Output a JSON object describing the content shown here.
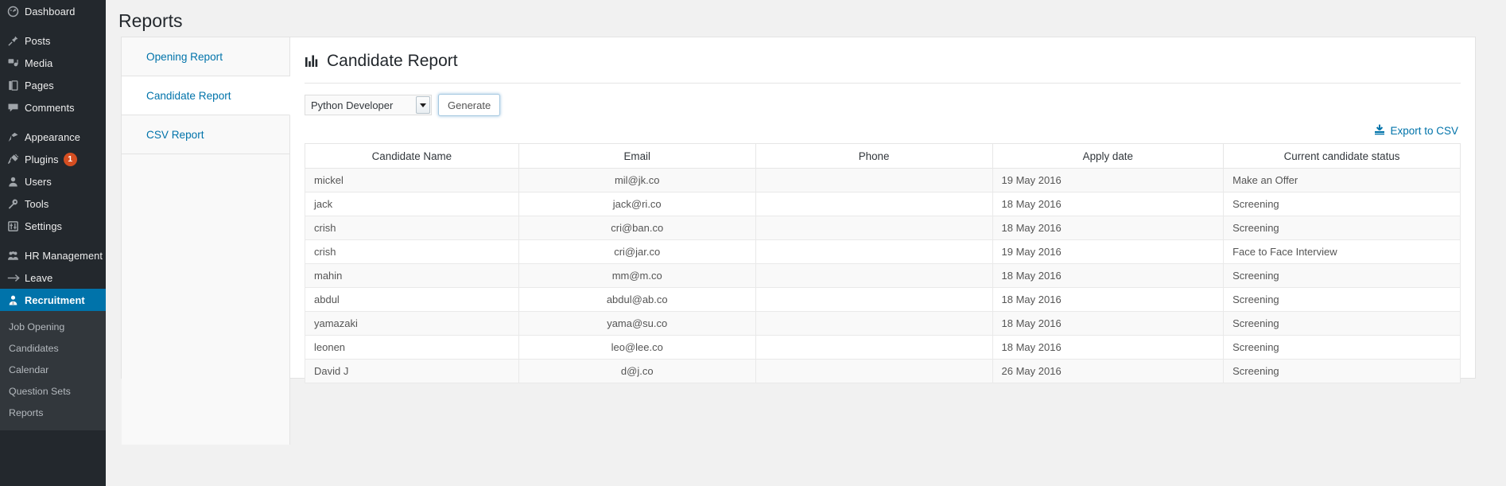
{
  "sidebar": {
    "groups": [
      {
        "items": [
          {
            "label": "Dashboard",
            "icon": "dashboard-gauge-icon",
            "name": "dashboard"
          }
        ]
      },
      {
        "items": [
          {
            "label": "Posts",
            "icon": "pin-icon",
            "name": "posts"
          },
          {
            "label": "Media",
            "icon": "media-icon",
            "name": "media"
          },
          {
            "label": "Pages",
            "icon": "pages-icon",
            "name": "pages"
          },
          {
            "label": "Comments",
            "icon": "comment-bubble-icon",
            "name": "comments"
          }
        ]
      },
      {
        "items": [
          {
            "label": "Appearance",
            "icon": "paintbrush-icon",
            "name": "appearance"
          },
          {
            "label": "Plugins",
            "icon": "plug-icon",
            "name": "plugins",
            "badge": "1"
          },
          {
            "label": "Users",
            "icon": "user-icon",
            "name": "users"
          },
          {
            "label": "Tools",
            "icon": "wrench-icon",
            "name": "tools"
          },
          {
            "label": "Settings",
            "icon": "sliders-icon",
            "name": "settings"
          }
        ]
      },
      {
        "items": [
          {
            "label": "HR Management",
            "icon": "group-people-icon",
            "name": "hr-management"
          },
          {
            "label": "Leave",
            "icon": "arrow-right-icon",
            "name": "leave"
          },
          {
            "label": "Recruitment",
            "icon": "user-badge-icon",
            "name": "recruitment",
            "current": true
          }
        ]
      }
    ],
    "submenu": {
      "items": [
        {
          "label": "Job Opening",
          "name": "job-opening"
        },
        {
          "label": "Candidates",
          "name": "candidates"
        },
        {
          "label": "Calendar",
          "name": "calendar"
        },
        {
          "label": "Question Sets",
          "name": "question-sets"
        },
        {
          "label": "Reports",
          "name": "reports"
        }
      ]
    },
    "colors": {
      "background": "#23282d",
      "submenu_background": "#32373c",
      "current": "#0073aa",
      "badge": "#d54e21"
    }
  },
  "page": {
    "title": "Reports"
  },
  "tabs": [
    {
      "label": "Opening Report",
      "name": "tab-opening-report",
      "active": false
    },
    {
      "label": "Candidate Report",
      "name": "tab-candidate-report",
      "active": true
    },
    {
      "label": "CSV Report",
      "name": "tab-csv-report",
      "active": false
    }
  ],
  "report": {
    "heading": "Candidate Report",
    "heading_icon": "bar-chart-icon",
    "job_select": {
      "value": "Python Developer",
      "options": [
        "Python Developer"
      ]
    },
    "generate_label": "Generate",
    "export_label": "Export to CSV",
    "export_icon": "download-icon",
    "link_color": "#0073aa"
  },
  "table": {
    "headers": [
      "Candidate Name",
      "Email",
      "Phone",
      "Apply date",
      "Current candidate status"
    ],
    "rows": [
      {
        "name": "mickel",
        "email": "mil@jk.co",
        "phone": "",
        "apply_date": "19 May 2016",
        "status": "Make an Offer"
      },
      {
        "name": "jack",
        "email": "jack@ri.co",
        "phone": "",
        "apply_date": "18 May 2016",
        "status": "Screening"
      },
      {
        "name": "crish",
        "email": "cri@ban.co",
        "phone": "",
        "apply_date": "18 May 2016",
        "status": "Screening"
      },
      {
        "name": "crish",
        "email": "cri@jar.co",
        "phone": "",
        "apply_date": "19 May 2016",
        "status": "Face to Face Interview"
      },
      {
        "name": "mahin",
        "email": "mm@m.co",
        "phone": "",
        "apply_date": "18 May 2016",
        "status": "Screening"
      },
      {
        "name": "abdul",
        "email": "abdul@ab.co",
        "phone": "",
        "apply_date": "18 May 2016",
        "status": "Screening"
      },
      {
        "name": "yamazaki",
        "email": "yama@su.co",
        "phone": "",
        "apply_date": "18 May 2016",
        "status": "Screening"
      },
      {
        "name": "leonen",
        "email": "leo@lee.co",
        "phone": "",
        "apply_date": "18 May 2016",
        "status": "Screening"
      },
      {
        "name": "David J",
        "email": "d@j.co",
        "phone": "",
        "apply_date": "26 May 2016",
        "status": "Screening"
      }
    ]
  }
}
